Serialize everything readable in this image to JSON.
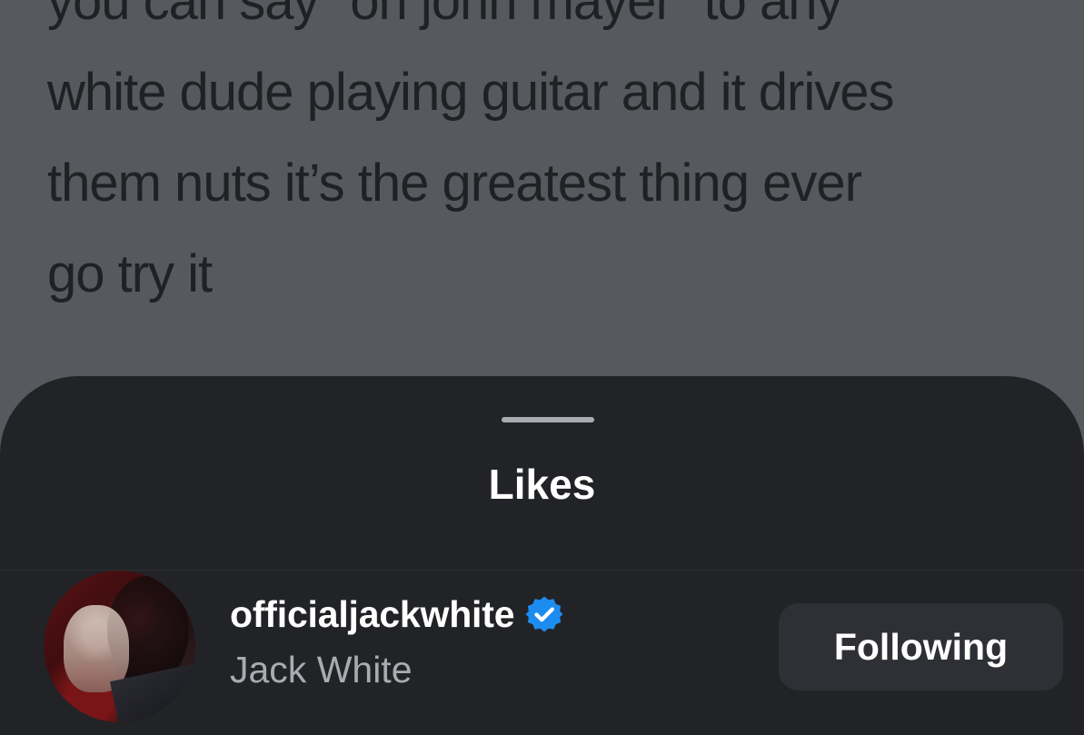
{
  "background_post": {
    "lines": [
      "you can say \"oh john mayer\" to any",
      "white dude playing guitar and it drives",
      "them nuts it’s the greatest thing ever",
      "go try it"
    ]
  },
  "sheet": {
    "title": "Likes",
    "likes": [
      {
        "username": "officialjackwhite",
        "full_name": "Jack White",
        "verified": true,
        "button_label": "Following"
      }
    ]
  },
  "colors": {
    "overlay_background": "#56595d",
    "sheet_background": "#222326",
    "verified_badge": "#1d8cf0",
    "button_background": "#2e3035",
    "secondary_text": "#a8abb0"
  },
  "icons": {
    "verified": "verified-badge-icon",
    "avatar": "profile-photo"
  }
}
